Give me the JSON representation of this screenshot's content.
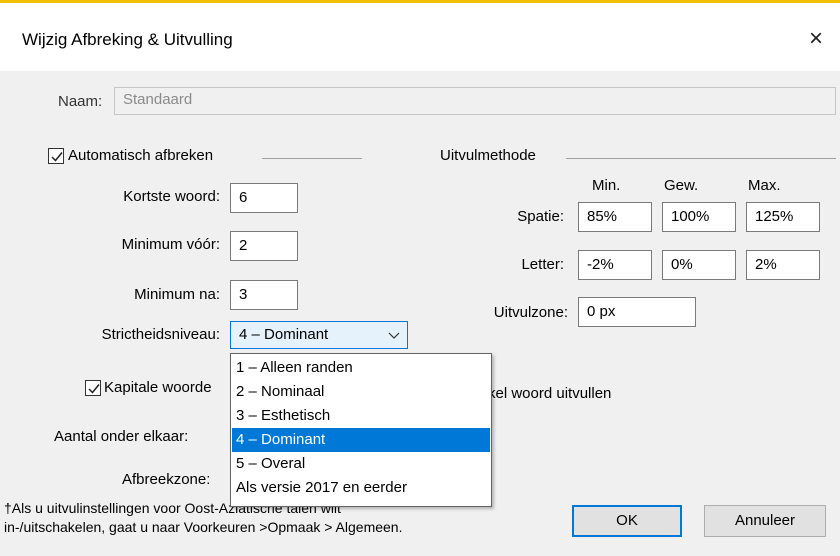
{
  "dialog": {
    "title": "Wijzig Afbreking & Uitvulling",
    "close_glyph": "×"
  },
  "name": {
    "label": "Naam:",
    "value": "Standaard"
  },
  "hyphenation": {
    "auto_label": "Automatisch afbreken",
    "auto_checked": true,
    "shortest_word_label": "Kortste woord:",
    "shortest_word_value": "6",
    "min_before_label": "Minimum vóór:",
    "min_before_value": "2",
    "min_after_label": "Minimum na:",
    "min_after_value": "3",
    "strictness_label": "Strictheidsniveau:",
    "strictness_value": "4 – Dominant",
    "strictness_options": [
      "1 – Alleen randen",
      "2 – Nominaal",
      "3 – Esthetisch",
      "4 – Dominant",
      "5 – Overal",
      "Als versie 2017 en eerder"
    ],
    "strictness_selected_index": 3,
    "capital_words_label": "Kapitale woorde",
    "capital_words_checked": true,
    "rows_label": "Aantal onder elkaar:",
    "zone_label": "Afbreekzone:"
  },
  "justification": {
    "group_label": "Uitvulmethode",
    "col_min": "Min.",
    "col_opt": "Gew.",
    "col_max": "Max.",
    "space_label": "Spatie:",
    "space_min": "85%",
    "space_opt": "100%",
    "space_max": "125%",
    "letter_label": "Letter:",
    "letter_min": "-2%",
    "letter_opt": "0%",
    "letter_max": "2%",
    "zone_label": "Uitvulzone:",
    "zone_value": "0 px",
    "single_word_partial": "kel woord uitvullen"
  },
  "footnote": {
    "line1": "†Als u uitvulinstellingen voor Oost-Aziatische talen wilt",
    "line2": "in-/uitschakelen, gaat u naar Voorkeuren >Opmaak > Algemeen."
  },
  "buttons": {
    "ok": "OK",
    "cancel": "Annuleer"
  },
  "colors": {
    "accent": "#0078d7",
    "dialog_bg": "#f0f0f0"
  }
}
